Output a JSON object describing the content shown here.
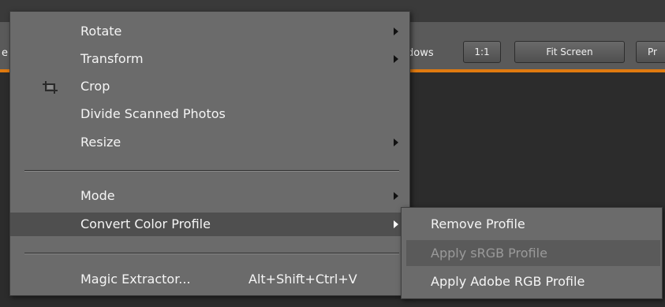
{
  "toolbar": {
    "partial_left": "e",
    "partial_windows": "dows",
    "one_to_one": "1:1",
    "fit_screen": "Fit Screen",
    "partial_next": "Pr"
  },
  "menu": {
    "items": [
      {
        "label": "Rotate",
        "has_submenu": true
      },
      {
        "label": "Transform",
        "has_submenu": true
      },
      {
        "label": "Crop",
        "icon": "crop-icon"
      },
      {
        "label": "Divide Scanned Photos"
      },
      {
        "label": "Resize",
        "has_submenu": true
      },
      {
        "label": "Mode",
        "has_submenu": true
      },
      {
        "label": "Convert Color Profile",
        "has_submenu": true,
        "highlighted": true
      },
      {
        "label": "Magic Extractor...",
        "shortcut": "Alt+Shift+Ctrl+V"
      }
    ]
  },
  "submenu": {
    "items": [
      {
        "label": "Remove Profile"
      },
      {
        "label": "Apply sRGB Profile",
        "disabled": true
      },
      {
        "label": "Apply Adobe RGB Profile"
      }
    ]
  },
  "colors": {
    "accent": "#e07a10",
    "menu_bg": "#6b6b6b",
    "menu_highlight": "#4f4f4f"
  }
}
